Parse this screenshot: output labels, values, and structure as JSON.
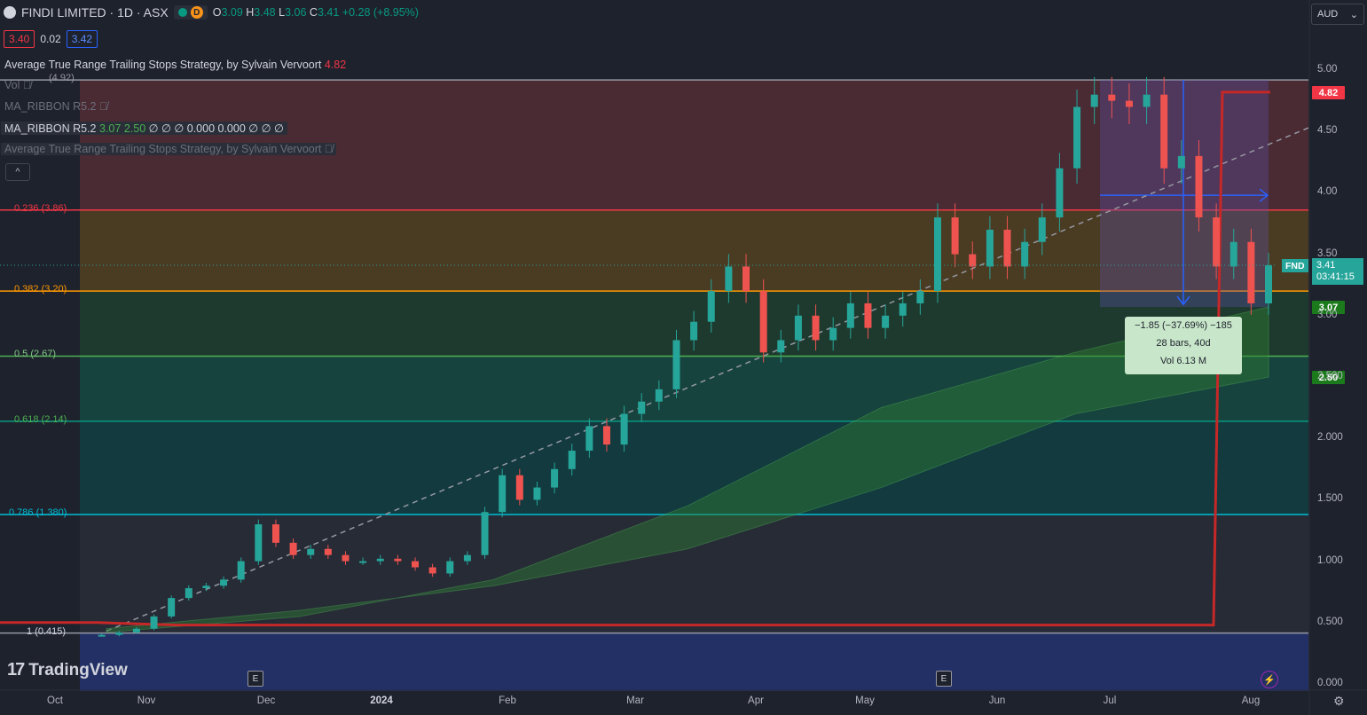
{
  "header": {
    "title": "FINDI LIMITED · 1D · ASX",
    "market_badge": "D",
    "ohlc": {
      "o_label": "O",
      "o": "3.09",
      "h_label": "H",
      "h": "3.48",
      "l_label": "L",
      "l": "3.06",
      "c_label": "C",
      "c": "3.41",
      "change": "+0.28 (+8.95%)"
    }
  },
  "trade": {
    "sell": "3.40",
    "spread": "0.02",
    "buy": "3.42"
  },
  "legend": {
    "atr_name": "Average True Range Trailing Stops Strategy, by Sylvain Vervoort",
    "atr_value": "4.82",
    "vol_label": "Vol",
    "ma_ribbon_hidden": "MA_RIBBON R5.2",
    "ma_ribbon": "MA_RIBBON R5.2",
    "ma_ribbon_v1": "3.07",
    "ma_ribbon_v2": "2.50",
    "ma_ribbon_rest": "∅ ∅ ∅ 0.000 0.000 ∅ ∅ ∅",
    "atr_hidden": "Average True Range Trailing Stops Strategy, by Sylvain Vervoort",
    "collapse": "^"
  },
  "currency": "AUD",
  "current_price": {
    "symbol": "FND",
    "price": "3.41",
    "countdown": "03:41:15"
  },
  "tags": {
    "atr": "4.82",
    "ma1": "3.07",
    "ma2": "2.50"
  },
  "measure": {
    "line1": "−1.85 (−37.69%) −185",
    "line2": "28 bars, 40d",
    "line3": "Vol 6.13 M"
  },
  "brand": "TradingView",
  "earnings_badge": "E",
  "colors": {
    "bg": "#1e222d",
    "up": "#26a69a",
    "down": "#ef5350",
    "atr": "#c62828",
    "ribbon": "#1b7a1b"
  },
  "chart_data": {
    "type": "candlestick",
    "title": "FINDI LIMITED · 1D · ASX",
    "y_axis": {
      "min": 0,
      "max": 5.0,
      "ticks": [
        "0.000",
        "0.500",
        "1.000",
        "1.500",
        "2.000",
        "2.500",
        "3.00",
        "3.50",
        "4.00",
        "4.50",
        "5.00"
      ]
    },
    "x_axis": {
      "labels": [
        "Oct",
        "Nov",
        "Dec",
        "2024",
        "Feb",
        "Mar",
        "Apr",
        "May",
        "Jun",
        "Jul",
        "Aug"
      ]
    },
    "fibonacci": [
      {
        "label": "1 (0.415)",
        "price": 0.415,
        "color": "#9598a1"
      },
      {
        "label": "0.786 (1.380)",
        "price": 1.38,
        "color": "#00bcd4"
      },
      {
        "label": "0.618 (2.14)",
        "price": 2.14,
        "color": "#089981"
      },
      {
        "label": "0.5 (2.67)",
        "price": 2.67,
        "color": "#4caf50"
      },
      {
        "label": "0.382 (3.20)",
        "price": 3.2,
        "color": "#ff9800"
      },
      {
        "label": "0.236 (3.86)",
        "price": 3.86,
        "color": "#f23645"
      },
      {
        "label": "0 (4.92)",
        "price": 4.92,
        "color": "#9598a1"
      }
    ],
    "close_path": [
      0.4,
      0.4,
      0.42,
      0.45,
      0.55,
      0.7,
      0.78,
      0.8,
      0.85,
      1.0,
      1.3,
      1.15,
      1.05,
      1.1,
      1.05,
      1.0,
      1.0,
      1.02,
      1.0,
      0.95,
      0.9,
      1.0,
      1.05,
      1.4,
      1.7,
      1.5,
      1.6,
      1.75,
      1.9,
      2.1,
      1.95,
      2.2,
      2.3,
      2.4,
      2.8,
      2.95,
      3.2,
      3.4,
      3.2,
      2.7,
      2.8,
      3.0,
      2.8,
      2.9,
      3.1,
      2.9,
      3.0,
      3.1,
      3.2,
      3.8,
      3.5,
      3.4,
      3.7,
      3.4,
      3.6,
      3.8,
      4.2,
      4.7,
      4.8,
      4.75,
      4.7,
      4.8,
      4.2,
      4.3,
      3.8,
      3.4,
      3.6,
      3.1,
      3.41
    ],
    "series": [
      {
        "name": "ATR Trailing Stop",
        "values": [
          0.5,
          0.5,
          0.48,
          0.48,
          4.82,
          4.82
        ]
      },
      {
        "name": "MA_RIBBON fast",
        "values": [
          0.42,
          0.55,
          0.85,
          1.45,
          2.25,
          2.7,
          3.07
        ]
      },
      {
        "name": "MA_RIBBON slow",
        "values": [
          0.45,
          0.6,
          0.8,
          1.1,
          1.6,
          2.2,
          2.5
        ]
      }
    ]
  }
}
